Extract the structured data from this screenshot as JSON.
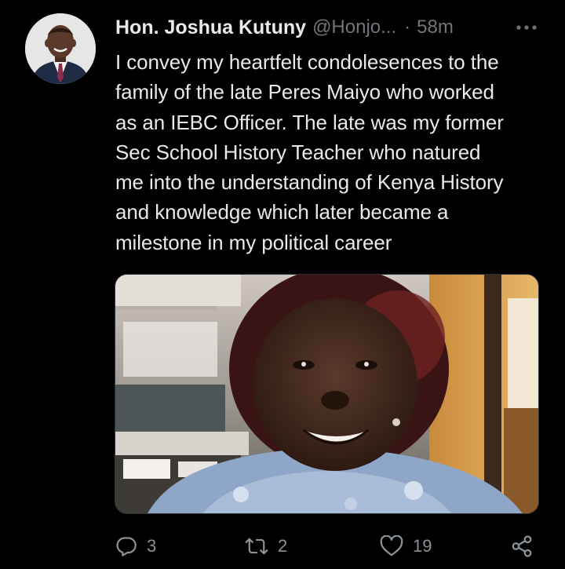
{
  "tweet": {
    "author_name": "Hon. Joshua Kutuny",
    "handle": "@Honjo...",
    "separator": "·",
    "time": "58m",
    "text": "I convey my heartfelt condolesences to the\nfamily of the late Peres Maiyo who worked\nas an IEBC Officer. The late was my former\nSec School History Teacher who natured\nme into the understanding of Kenya History\nand knowledge which later became a\nmilestone in my political career"
  },
  "actions": {
    "replies": "3",
    "retweets": "2",
    "likes": "19"
  },
  "icons": {
    "more": "more-horizontal-icon",
    "reply": "reply-icon",
    "retweet": "retweet-icon",
    "like": "heart-icon",
    "share": "share-icon"
  },
  "colors": {
    "background": "#000000",
    "text": "#e7e9ea",
    "secondary": "#71767b",
    "icon": "#8b9298"
  }
}
